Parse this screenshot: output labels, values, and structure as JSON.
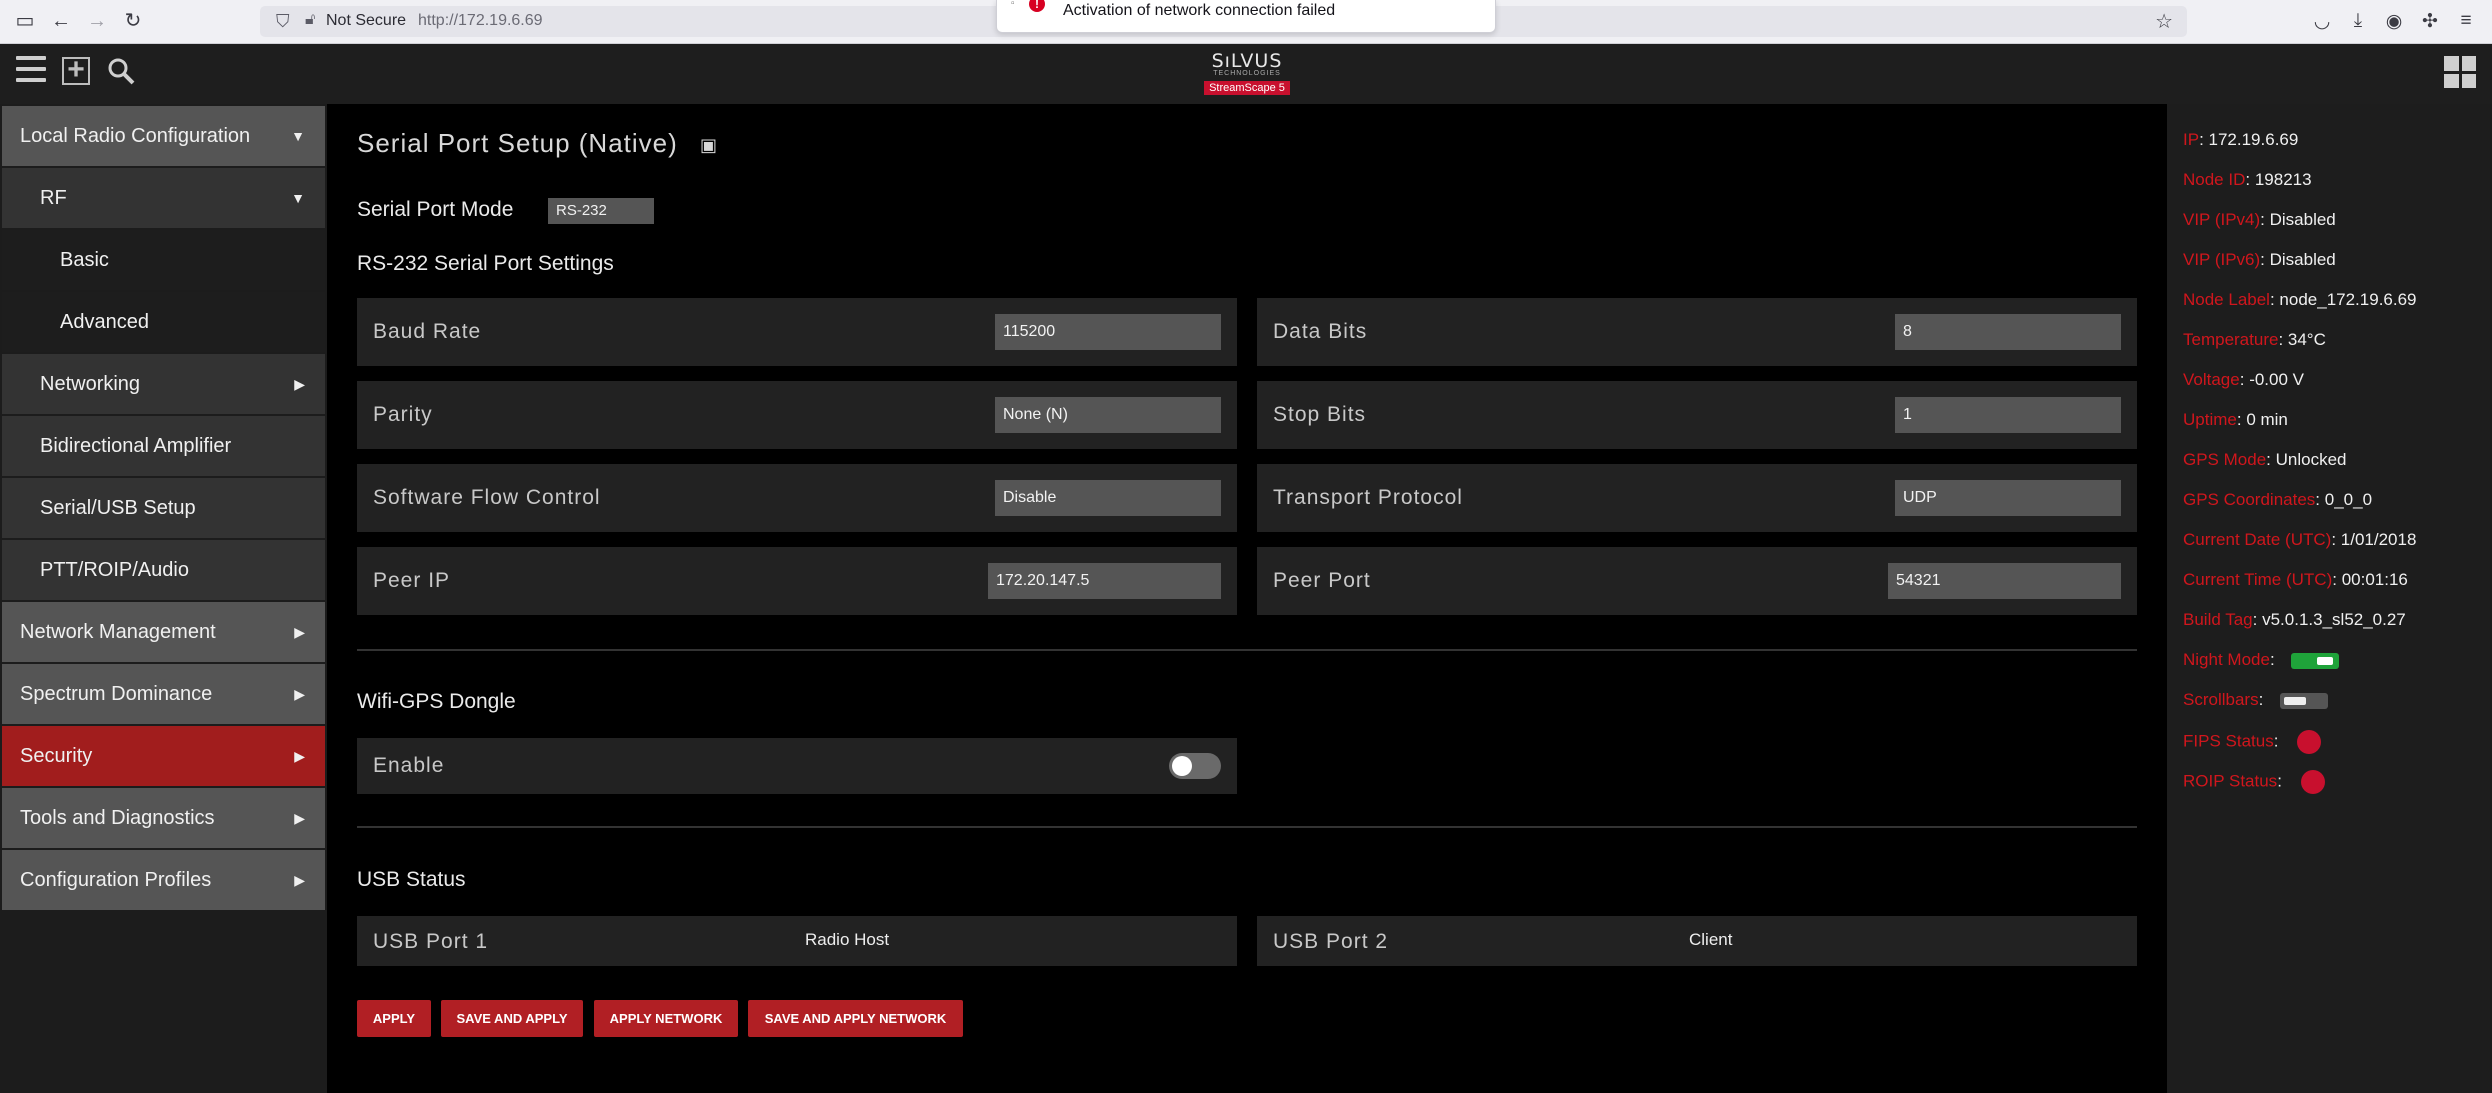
{
  "browser": {
    "not_secure": "Not Secure",
    "url": "http://172.19.6.69",
    "notification": "Activation of network connection failed"
  },
  "header": {
    "brand": "SıLVUS",
    "brand_sub": "TECHNOLOGIES",
    "badge": "StreamScape 5"
  },
  "sidebar": {
    "items": [
      {
        "label": "Local Radio Configuration",
        "arrow": "▼"
      },
      {
        "label": "RF",
        "arrow": "▼"
      },
      {
        "label": "Basic"
      },
      {
        "label": "Advanced"
      },
      {
        "label": "Networking",
        "arrow": "▶"
      },
      {
        "label": "Bidirectional Amplifier"
      },
      {
        "label": "Serial/USB Setup"
      },
      {
        "label": "PTT/ROIP/Audio"
      },
      {
        "label": "Network Management",
        "arrow": "▶"
      },
      {
        "label": "Spectrum Dominance",
        "arrow": "▶"
      },
      {
        "label": "Security",
        "arrow": "▶"
      },
      {
        "label": "Tools and Diagnostics",
        "arrow": "▶"
      },
      {
        "label": "Configuration Profiles",
        "arrow": "▶"
      }
    ]
  },
  "main": {
    "title": "Serial Port Setup (Native)",
    "serial_mode_label": "Serial Port Mode",
    "serial_mode_value": "RS-232",
    "rs232_heading": "RS-232 Serial Port Settings",
    "fields": {
      "baud_rate": {
        "label": "Baud Rate",
        "value": "115200"
      },
      "data_bits": {
        "label": "Data Bits",
        "value": "8"
      },
      "parity": {
        "label": "Parity",
        "value": "None (N)"
      },
      "stop_bits": {
        "label": "Stop Bits",
        "value": "1"
      },
      "sw_flow": {
        "label": "Software Flow Control",
        "value": "Disable"
      },
      "transport": {
        "label": "Transport Protocol",
        "value": "UDP"
      },
      "peer_ip": {
        "label": "Peer IP",
        "value": "172.20.147.5"
      },
      "peer_port": {
        "label": "Peer Port",
        "value": "54321"
      }
    },
    "wifi_heading": "Wifi-GPS Dongle",
    "wifi_enable_label": "Enable",
    "usb_heading": "USB Status",
    "usb1_label": "USB Port 1",
    "usb1_value": "Radio Host",
    "usb2_label": "USB Port 2",
    "usb2_value": "Client",
    "buttons": {
      "apply": "APPLY",
      "save_apply": "SAVE AND APPLY",
      "apply_network": "APPLY NETWORK",
      "save_apply_network": "SAVE AND APPLY NETWORK"
    }
  },
  "info": {
    "ip_k": "IP",
    "ip_v": "172.19.6.69",
    "node_id_k": "Node ID",
    "node_id_v": "198213",
    "vip4_k": "VIP (IPv4)",
    "vip4_v": "Disabled",
    "vip6_k": "VIP (IPv6)",
    "vip6_v": "Disabled",
    "node_label_k": "Node Label",
    "node_label_v": "node_172.19.6.69",
    "temp_k": "Temperature",
    "temp_v": "34°C",
    "voltage_k": "Voltage",
    "voltage_v": "-0.00 V",
    "uptime_k": "Uptime",
    "uptime_v": "0 min",
    "gps_mode_k": "GPS Mode",
    "gps_mode_v": "Unlocked",
    "gps_coord_k": "GPS Coordinates",
    "gps_coord_v": "0_0_0",
    "date_k": "Current Date (UTC)",
    "date_v": "1/01/2018",
    "time_k": "Current Time (UTC)",
    "time_v": "00:01:16",
    "build_k": "Build Tag",
    "build_v": "v5.0.1.3_sl52_0.27",
    "night_k": "Night Mode",
    "scroll_k": "Scrollbars",
    "fips_k": "FIPS Status",
    "roip_k": "ROIP Status"
  },
  "colors": {
    "accent_red": "#b11f24",
    "status_red": "#d0161d",
    "toggle_on": "#1fa33a"
  }
}
